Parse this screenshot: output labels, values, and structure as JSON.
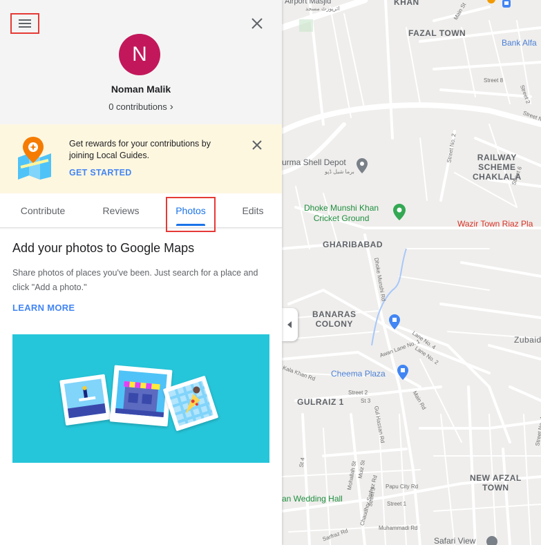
{
  "panel": {
    "menu_icon": "hamburger-menu-icon",
    "close_icon": "close-icon",
    "profile": {
      "avatar_initial": "N",
      "avatar_color": "#c2185b",
      "name": "Noman Malik",
      "contributions": "0 contributions",
      "contributions_chevron": "›"
    },
    "promo": {
      "text": "Get rewards for your contributions by joining Local Guides.",
      "cta": "GET STARTED",
      "close_icon": "close-icon",
      "background": "#fef7e0"
    },
    "tabs": [
      {
        "label": "Contribute",
        "active": false
      },
      {
        "label": "Reviews",
        "active": false
      },
      {
        "label": "Photos",
        "active": true
      },
      {
        "label": "Edits",
        "active": false
      }
    ],
    "content": {
      "title": "Add your photos to Google Maps",
      "description": "Share photos of places you've been. Just search for a place and click \"Add a photo.\"",
      "learn_more": "LEARN MORE",
      "banner_color": "#26c6da"
    },
    "accent_color": "#1a73e8",
    "highlight_color": "#e53935"
  },
  "map": {
    "collapse_icon": "chevron-left-icon",
    "areas": {
      "khan": "KHAN",
      "fazal_town": "FAZAL TOWN",
      "railway_scheme": "RAILWAY\nSCHEME\nCHAKLALA",
      "gharibabad": "GHARIBABAD",
      "banaras_colony": "BANARAS\nCOLONY",
      "gulraiz": "GULRAIZ 1",
      "new_afzal_town": "NEW AFZAL\nTOWN",
      "zubaid": "Zubaid"
    },
    "pois": {
      "airport_masjid": "Airport Masjid",
      "bank_alfa": "Bank Alfa",
      "burma_shell": "urma Shell Depot",
      "dhoke_munshi": "Dhoke Munshi Khan\nCricket Ground",
      "wazir_town": "Wazir Town Riaz Pla",
      "cheema_plaza": "Cheema Plaza",
      "wedding_hall": "an Wedding Hall",
      "safari_view": "Safari View"
    },
    "streets": {
      "main_st": "Main St",
      "street_8": "Street 8",
      "street_2": "Street 2",
      "street_no_2": "Street No. 2",
      "street_no_1": "Street No. 1",
      "street_6": "Street 6",
      "dhoke_munshi_rd": "Dhoke Munshi Rd",
      "lane_4": "Lane No. 4",
      "lane_2": "Lane No. 2",
      "awan_lane_1": "Awan Lane No. 1",
      "kala_khan_rd": "Kala Khan Rd",
      "main_rd": "Main Rd",
      "street_2b": "Street 2",
      "st_3": "St 3",
      "gul_hassan_rd": "Gul Hassan Rd",
      "st_4": "St 4",
      "mohallah_st": "Mohallah St",
      "muiz_st": "Muiz St",
      "chaudhry_sarfraz_rd": "Chaudhry Sarfraz Rd",
      "street_3": "Street 3",
      "papu_city_rd": "Papu City Rd",
      "street_1": "Street 1",
      "muhammadi_rd": "Muhammadi Rd",
      "street_no_4": "Street No. 4",
      "sarfraz_rd": "Sarfraz Rd"
    }
  }
}
